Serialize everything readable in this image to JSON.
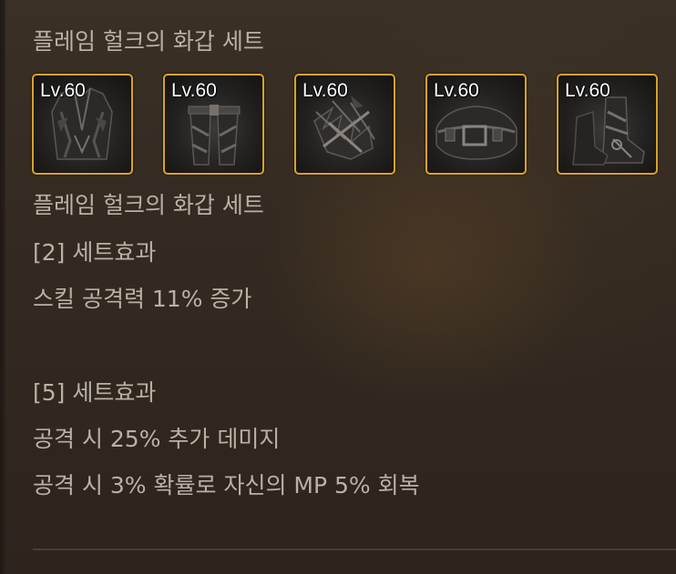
{
  "set_title": "플레임 헐크의 화갑 세트",
  "items": [
    {
      "level": "Lv.60",
      "icon": "jacket-armor-icon"
    },
    {
      "level": "Lv.60",
      "icon": "pants-armor-icon"
    },
    {
      "level": "Lv.60",
      "icon": "shoulder-armor-icon"
    },
    {
      "level": "Lv.60",
      "icon": "belt-armor-icon"
    },
    {
      "level": "Lv.60",
      "icon": "boots-armor-icon"
    }
  ],
  "set_name": "플레임 헐크의 화갑 세트",
  "bonuses": [
    {
      "header": "[2] 세트효과",
      "effects": [
        "스킬 공격력 11% 증가"
      ]
    },
    {
      "header": "[5] 세트효과",
      "effects": [
        "공격 시 25% 추가 데미지",
        "공격 시 3% 확률로 자신의 MP 5% 회복"
      ]
    }
  ],
  "colors": {
    "text": "#b9b1a6",
    "slot_border": "#d8a22a",
    "background": "#332a21"
  }
}
